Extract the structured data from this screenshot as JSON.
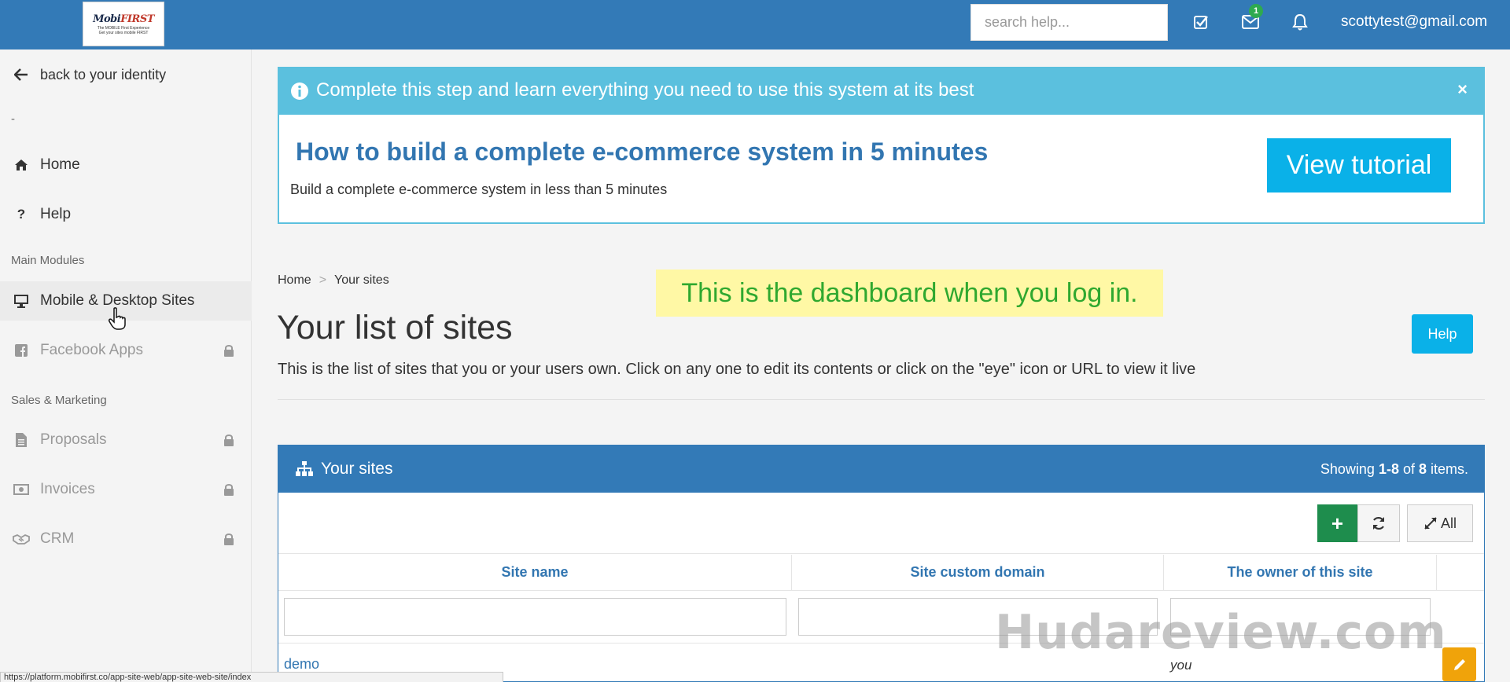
{
  "topbar": {
    "logo": {
      "brand_a": "Mobi",
      "brand_b": "FIRST",
      "tagline_1": "The MOBILE First Experience",
      "tagline_2": "Get your sites mobile FIRST"
    },
    "search_placeholder": "search help...",
    "notification_count": "1",
    "user_email": "scottytest@gmail.com"
  },
  "sidebar": {
    "back_label": "back to your identity",
    "separator": "-",
    "home_label": "Home",
    "help_label": "Help",
    "section_main": "Main Modules",
    "mobile_sites_label": "Mobile & Desktop Sites",
    "facebook_label": "Facebook Apps",
    "section_sales": "Sales & Marketing",
    "proposals_label": "Proposals",
    "invoices_label": "Invoices",
    "crm_label": "CRM"
  },
  "banner": {
    "header": "Complete this step and learn everything you need to use this system at its best",
    "close": "×",
    "title": "How to build a complete e-commerce system in 5 minutes",
    "subtitle": "Build a complete e-commerce system in less than 5 minutes",
    "button": "View tutorial"
  },
  "breadcrumb": {
    "home": "Home",
    "sep": ">",
    "current": "Your sites"
  },
  "page": {
    "title": "Your list of sites",
    "description": "This is the list of sites that you or your users own. Click on any one to edit its contents or click on the \"eye\" icon or URL to view it live",
    "help_button": "Help"
  },
  "annotation": "This is the dashboard when you log in.",
  "panel": {
    "title": "Your sites",
    "summary_prefix": "Showing ",
    "summary_range": "1-8",
    "summary_mid": " of ",
    "summary_total": "8",
    "summary_suffix": " items.",
    "add_label": "+",
    "all_label": "All",
    "columns": [
      "Site name",
      "Site custom domain",
      "The owner of this site"
    ],
    "rows": [
      {
        "name": "demo",
        "owner": "you"
      }
    ]
  },
  "watermark": "Hudareview.com",
  "status_url": "https://platform.mobifirst.co/app-site-web/app-site-web-site/index"
}
